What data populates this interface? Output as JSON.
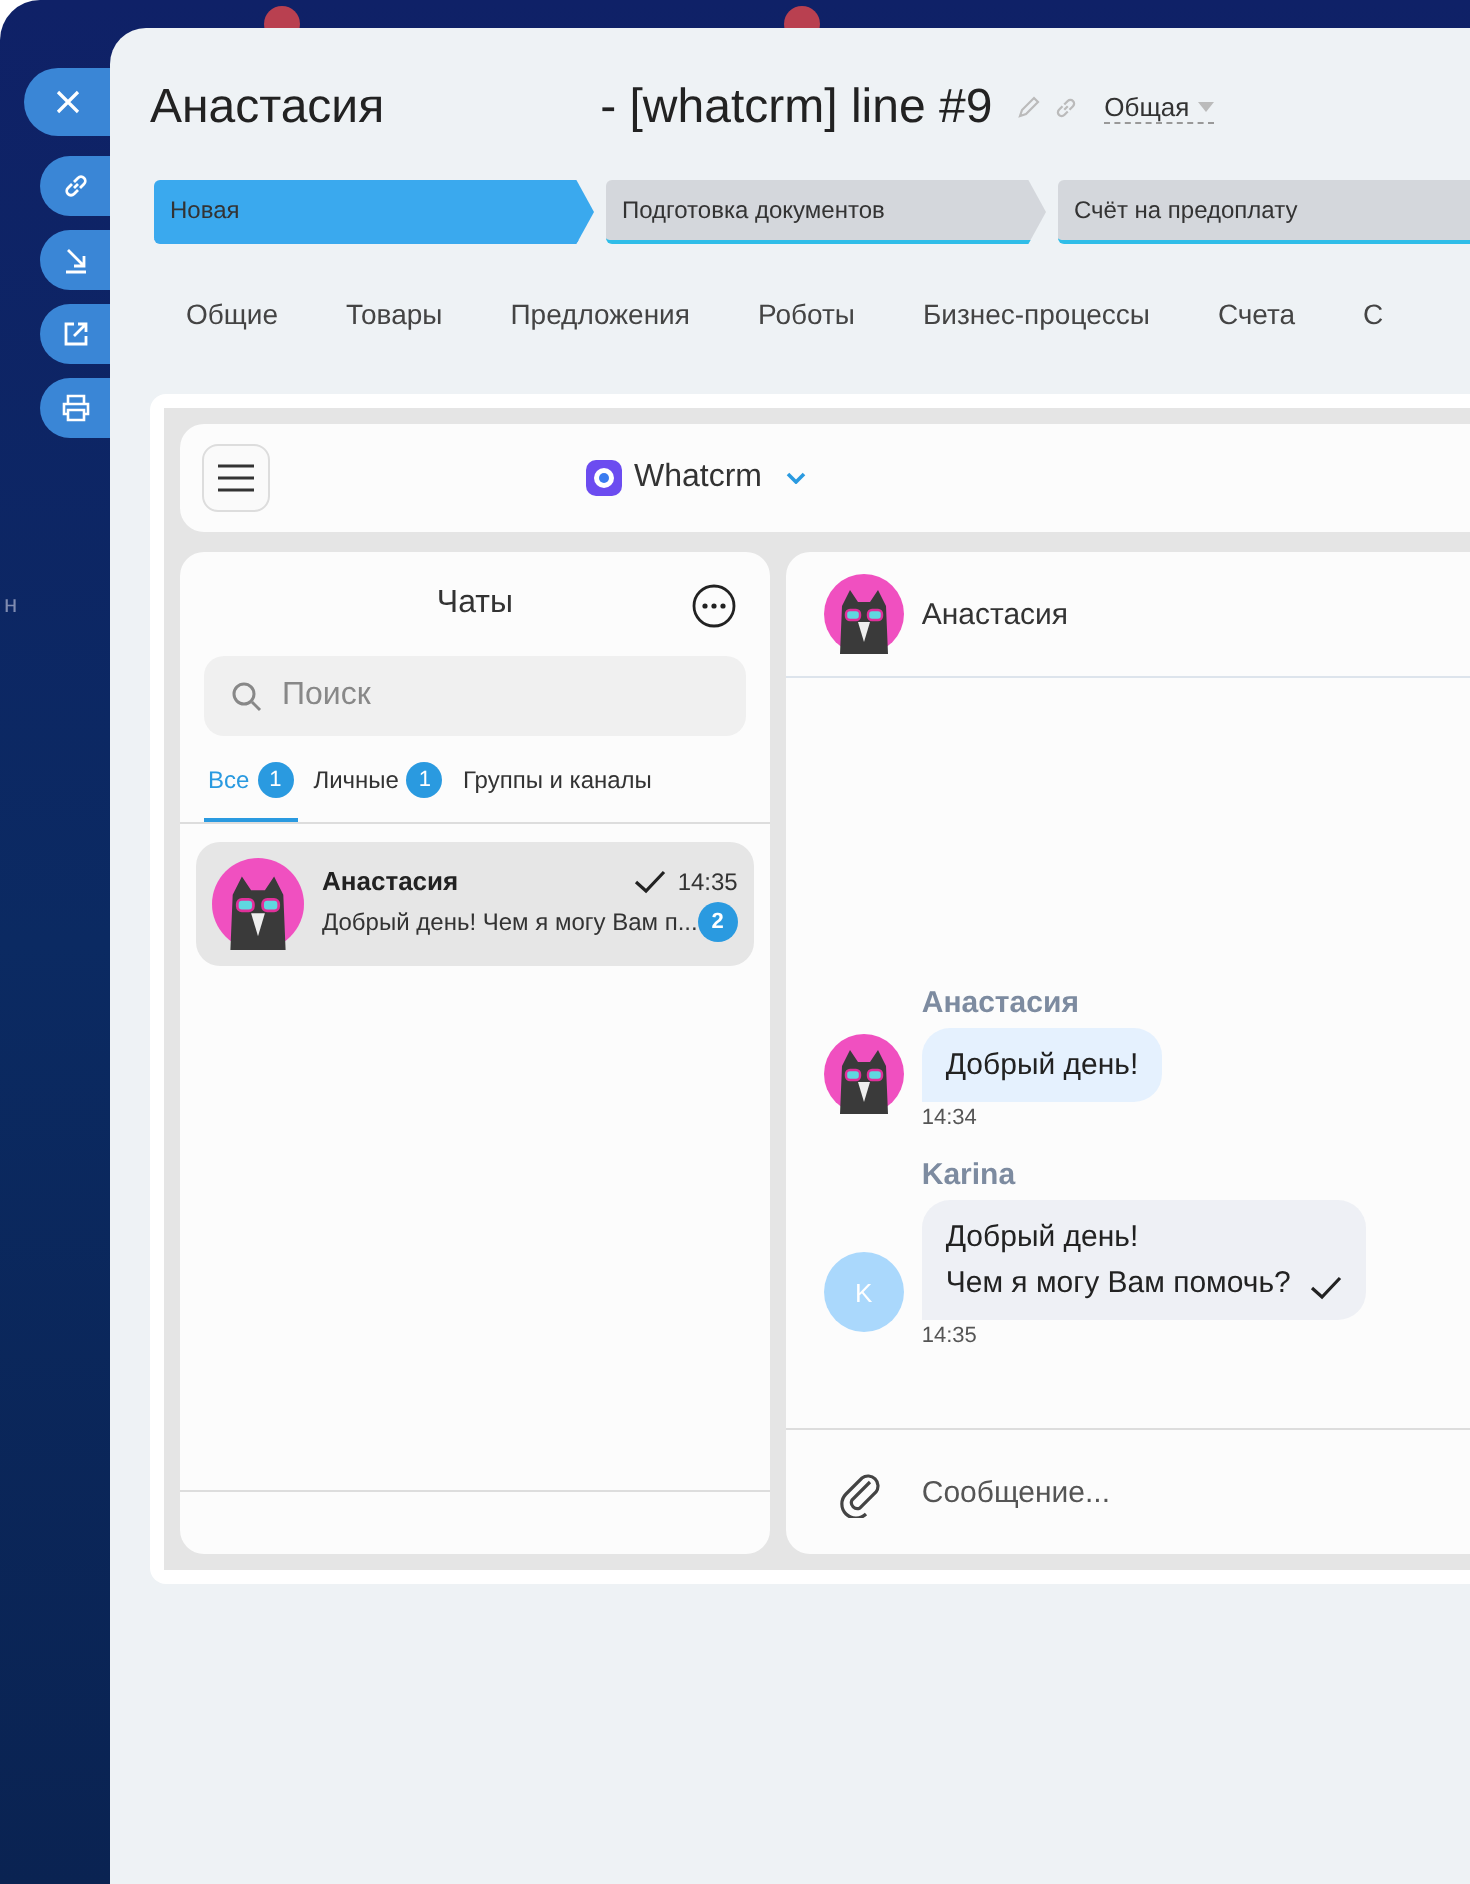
{
  "background": {
    "fragment": "н"
  },
  "header": {
    "title": "Анастасия",
    "subtitle": "- [whatcrm] line #9",
    "category": "Общая"
  },
  "stages": [
    {
      "label": "Новая",
      "selected": true
    },
    {
      "label": "Подготовка документов",
      "selected": false
    },
    {
      "label": "Счёт на предоплату",
      "selected": false
    }
  ],
  "tabs": [
    {
      "label": "Общие"
    },
    {
      "label": "Товары"
    },
    {
      "label": "Предложения"
    },
    {
      "label": "Роботы"
    },
    {
      "label": "Бизнес-процессы"
    },
    {
      "label": "Счета"
    },
    {
      "label": "С"
    }
  ],
  "app_bar": {
    "brand": "Whatcrm"
  },
  "chats_panel": {
    "title": "Чаты",
    "search": {
      "placeholder": "Поиск"
    },
    "filters": [
      {
        "label": "Все",
        "count": "1",
        "selected": true
      },
      {
        "label": "Личные",
        "count": "1",
        "selected": false
      },
      {
        "label": "Группы и каналы",
        "selected": false
      }
    ],
    "chats": [
      {
        "name": "Анастасия",
        "time": "14:35",
        "preview": "Добрый день! Чем я могу Вам п...",
        "unread": "2",
        "selected": true,
        "read": true
      }
    ]
  },
  "conversation": {
    "contact": "Анастасия",
    "messages": [
      {
        "author": "Анастасия",
        "lines": [
          "Добрый день!"
        ],
        "time": "14:34",
        "color": "#e5f1fe",
        "avatar": {
          "kind": "photo"
        },
        "read": false
      },
      {
        "author": "Karina",
        "lines": [
          "Добрый день!",
          "Чем я могу Вам помочь?"
        ],
        "time": "14:35",
        "color": "#eef0f5",
        "avatar": {
          "kind": "letter",
          "letter": "K"
        },
        "read": true
      }
    ],
    "composer": {
      "placeholder": "Сообщение..."
    }
  }
}
